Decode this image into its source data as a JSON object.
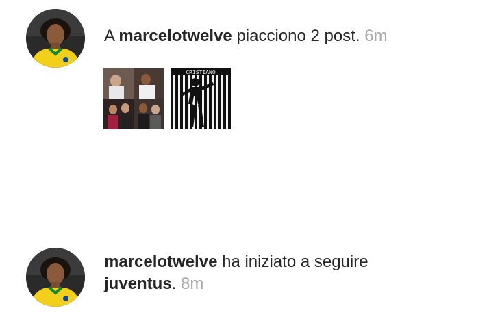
{
  "notifications": [
    {
      "prefix": "A ",
      "username": "marcelotwelve",
      "action": " piacciono 2 post.",
      "time": "6m",
      "avatar_icon": "profile-avatar",
      "thumbnails": [
        {
          "icon": "photo-collage-thumbnail"
        },
        {
          "icon": "cristiano-poster-thumbnail",
          "text": "CRISTIANO"
        }
      ]
    },
    {
      "username": "marcelotwelve",
      "action_line1": " ha iniziato a seguire",
      "target": "juventus",
      "suffix": ".",
      "time": "8m",
      "avatar_icon": "profile-avatar"
    }
  ],
  "colors": {
    "text": "#262626",
    "time": "#a8a8a8",
    "background": "#ffffff",
    "jersey_yellow": "#f2cf1a",
    "jersey_green": "#0d8a3a"
  }
}
